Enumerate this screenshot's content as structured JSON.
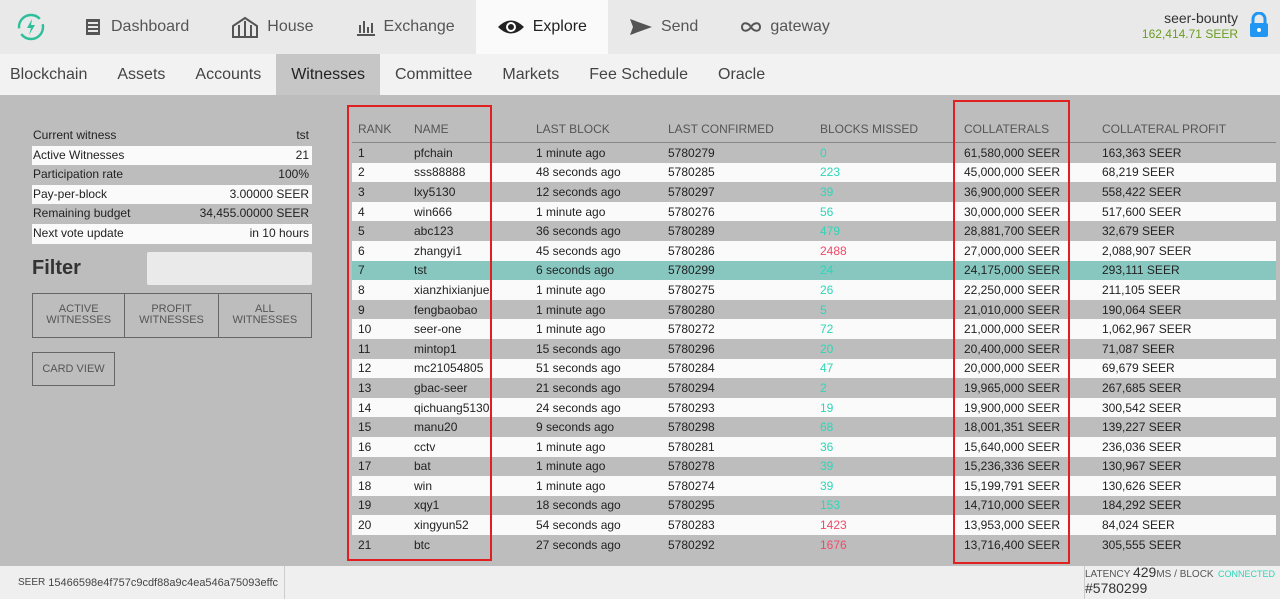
{
  "nav": {
    "items": [
      {
        "label": "Dashboard",
        "icon": "dashboard-icon"
      },
      {
        "label": "House",
        "icon": "house-icon"
      },
      {
        "label": "Exchange",
        "icon": "exchange-icon"
      },
      {
        "label": "Explore",
        "icon": "eye-icon",
        "active": true
      },
      {
        "label": "Send",
        "icon": "send-icon"
      },
      {
        "label": "gateway",
        "icon": "infinity-icon"
      }
    ]
  },
  "account": {
    "name": "seer-bounty",
    "balance": "162,414.71 SEER"
  },
  "subnav": {
    "items": [
      "Blockchain",
      "Assets",
      "Accounts",
      "Witnesses",
      "Committee",
      "Markets",
      "Fee Schedule",
      "Oracle"
    ],
    "active": "Witnesses"
  },
  "stats": [
    {
      "label": "Current witness",
      "value": "tst"
    },
    {
      "label": "Active Witnesses",
      "value": "21"
    },
    {
      "label": "Participation rate",
      "value": "100%"
    },
    {
      "label": "Pay-per-block",
      "value": "3.00000 SEER"
    },
    {
      "label": "Remaining budget",
      "value": "34,455.00000 SEER"
    },
    {
      "label": "Next vote update",
      "value": "in 10 hours"
    }
  ],
  "filter": {
    "label": "Filter",
    "placeholder": ""
  },
  "buttons": {
    "active": "ACTIVE\nWITNESSES",
    "profit": "PROFIT\nWITNESSES",
    "all": "ALL\nWITNESSES",
    "card_view": "CARD VIEW"
  },
  "table": {
    "headers": [
      "RANK",
      "NAME",
      "LAST BLOCK",
      "LAST CONFIRMED",
      "BLOCKS MISSED",
      "COLLATERALS",
      "COLLATERAL PROFIT"
    ],
    "rows": [
      {
        "rank": "1",
        "name": "pfchain",
        "last": "1 minute ago",
        "conf": "5780279",
        "missed": "0",
        "coll": "61,580,000 SEER",
        "profit": "163,363 SEER"
      },
      {
        "rank": "2",
        "name": "sss88888",
        "last": "48 seconds ago",
        "conf": "5780285",
        "missed": "223",
        "coll": "45,000,000 SEER",
        "profit": "68,219 SEER"
      },
      {
        "rank": "3",
        "name": "lxy5130",
        "last": "12 seconds ago",
        "conf": "5780297",
        "missed": "39",
        "coll": "36,900,000 SEER",
        "profit": "558,422 SEER"
      },
      {
        "rank": "4",
        "name": "win666",
        "last": "1 minute ago",
        "conf": "5780276",
        "missed": "56",
        "coll": "30,000,000 SEER",
        "profit": "517,600 SEER"
      },
      {
        "rank": "5",
        "name": "abc123",
        "last": "36 seconds ago",
        "conf": "5780289",
        "missed": "479",
        "coll": "28,881,700 SEER",
        "profit": "32,679 SEER"
      },
      {
        "rank": "6",
        "name": "zhangyi1",
        "last": "45 seconds ago",
        "conf": "5780286",
        "missed": "2488",
        "coll": "27,000,000 SEER",
        "profit": "2,088,907 SEER"
      },
      {
        "rank": "7",
        "name": "tst",
        "last": "6 seconds ago",
        "conf": "5780299",
        "missed": "24",
        "coll": "24,175,000 SEER",
        "profit": "293,111 SEER"
      },
      {
        "rank": "8",
        "name": "xianzhixianjue",
        "last": "1 minute ago",
        "conf": "5780275",
        "missed": "26",
        "coll": "22,250,000 SEER",
        "profit": "211,105 SEER"
      },
      {
        "rank": "9",
        "name": "fengbaobao",
        "last": "1 minute ago",
        "conf": "5780280",
        "missed": "5",
        "coll": "21,010,000 SEER",
        "profit": "190,064 SEER"
      },
      {
        "rank": "10",
        "name": "seer-one",
        "last": "1 minute ago",
        "conf": "5780272",
        "missed": "72",
        "coll": "21,000,000 SEER",
        "profit": "1,062,967 SEER"
      },
      {
        "rank": "11",
        "name": "mintop1",
        "last": "15 seconds ago",
        "conf": "5780296",
        "missed": "20",
        "coll": "20,400,000 SEER",
        "profit": "71,087 SEER"
      },
      {
        "rank": "12",
        "name": "mc21054805",
        "last": "51 seconds ago",
        "conf": "5780284",
        "missed": "47",
        "coll": "20,000,000 SEER",
        "profit": "69,679 SEER"
      },
      {
        "rank": "13",
        "name": "gbac-seer",
        "last": "21 seconds ago",
        "conf": "5780294",
        "missed": "2",
        "coll": "19,965,000 SEER",
        "profit": "267,685 SEER"
      },
      {
        "rank": "14",
        "name": "qichuang5130",
        "last": "24 seconds ago",
        "conf": "5780293",
        "missed": "19",
        "coll": "19,900,000 SEER",
        "profit": "300,542 SEER"
      },
      {
        "rank": "15",
        "name": "manu20",
        "last": "9 seconds ago",
        "conf": "5780298",
        "missed": "68",
        "coll": "18,001,351 SEER",
        "profit": "139,227 SEER"
      },
      {
        "rank": "16",
        "name": "cctv",
        "last": "1 minute ago",
        "conf": "5780281",
        "missed": "36",
        "coll": "15,640,000 SEER",
        "profit": "236,036 SEER"
      },
      {
        "rank": "17",
        "name": "bat",
        "last": "1 minute ago",
        "conf": "5780278",
        "missed": "39",
        "coll": "15,236,336 SEER",
        "profit": "130,967 SEER"
      },
      {
        "rank": "18",
        "name": "win",
        "last": "1 minute ago",
        "conf": "5780274",
        "missed": "39",
        "coll": "15,199,791 SEER",
        "profit": "130,626 SEER"
      },
      {
        "rank": "19",
        "name": "xqy1",
        "last": "18 seconds ago",
        "conf": "5780295",
        "missed": "153",
        "coll": "14,710,000 SEER",
        "profit": "184,292 SEER"
      },
      {
        "rank": "20",
        "name": "xingyun52",
        "last": "54 seconds ago",
        "conf": "5780283",
        "missed": "1423",
        "coll": "13,953,000 SEER",
        "profit": "84,024 SEER"
      },
      {
        "rank": "21",
        "name": "btc",
        "last": "27 seconds ago",
        "conf": "5780292",
        "missed": "1676",
        "coll": "13,716,400 SEER",
        "profit": "305,555 SEER"
      }
    ]
  },
  "footer": {
    "seer_label": "SEER",
    "hash": "15466598e4f757c9cdf88a9c4ea546a75093effc",
    "connected": "CONNECTED",
    "latency_label": "LATENCY",
    "latency_value": "429",
    "latency_unit": "MS",
    "block_label": "BLOCK",
    "block_value": "#5780299"
  },
  "colors": {
    "accent_green": "#2dd6b7",
    "missed_red": "#f04a6a",
    "highlight_row": "#88c7c0",
    "balance_green": "#6a9e1f",
    "lock_blue": "#2196f3"
  }
}
